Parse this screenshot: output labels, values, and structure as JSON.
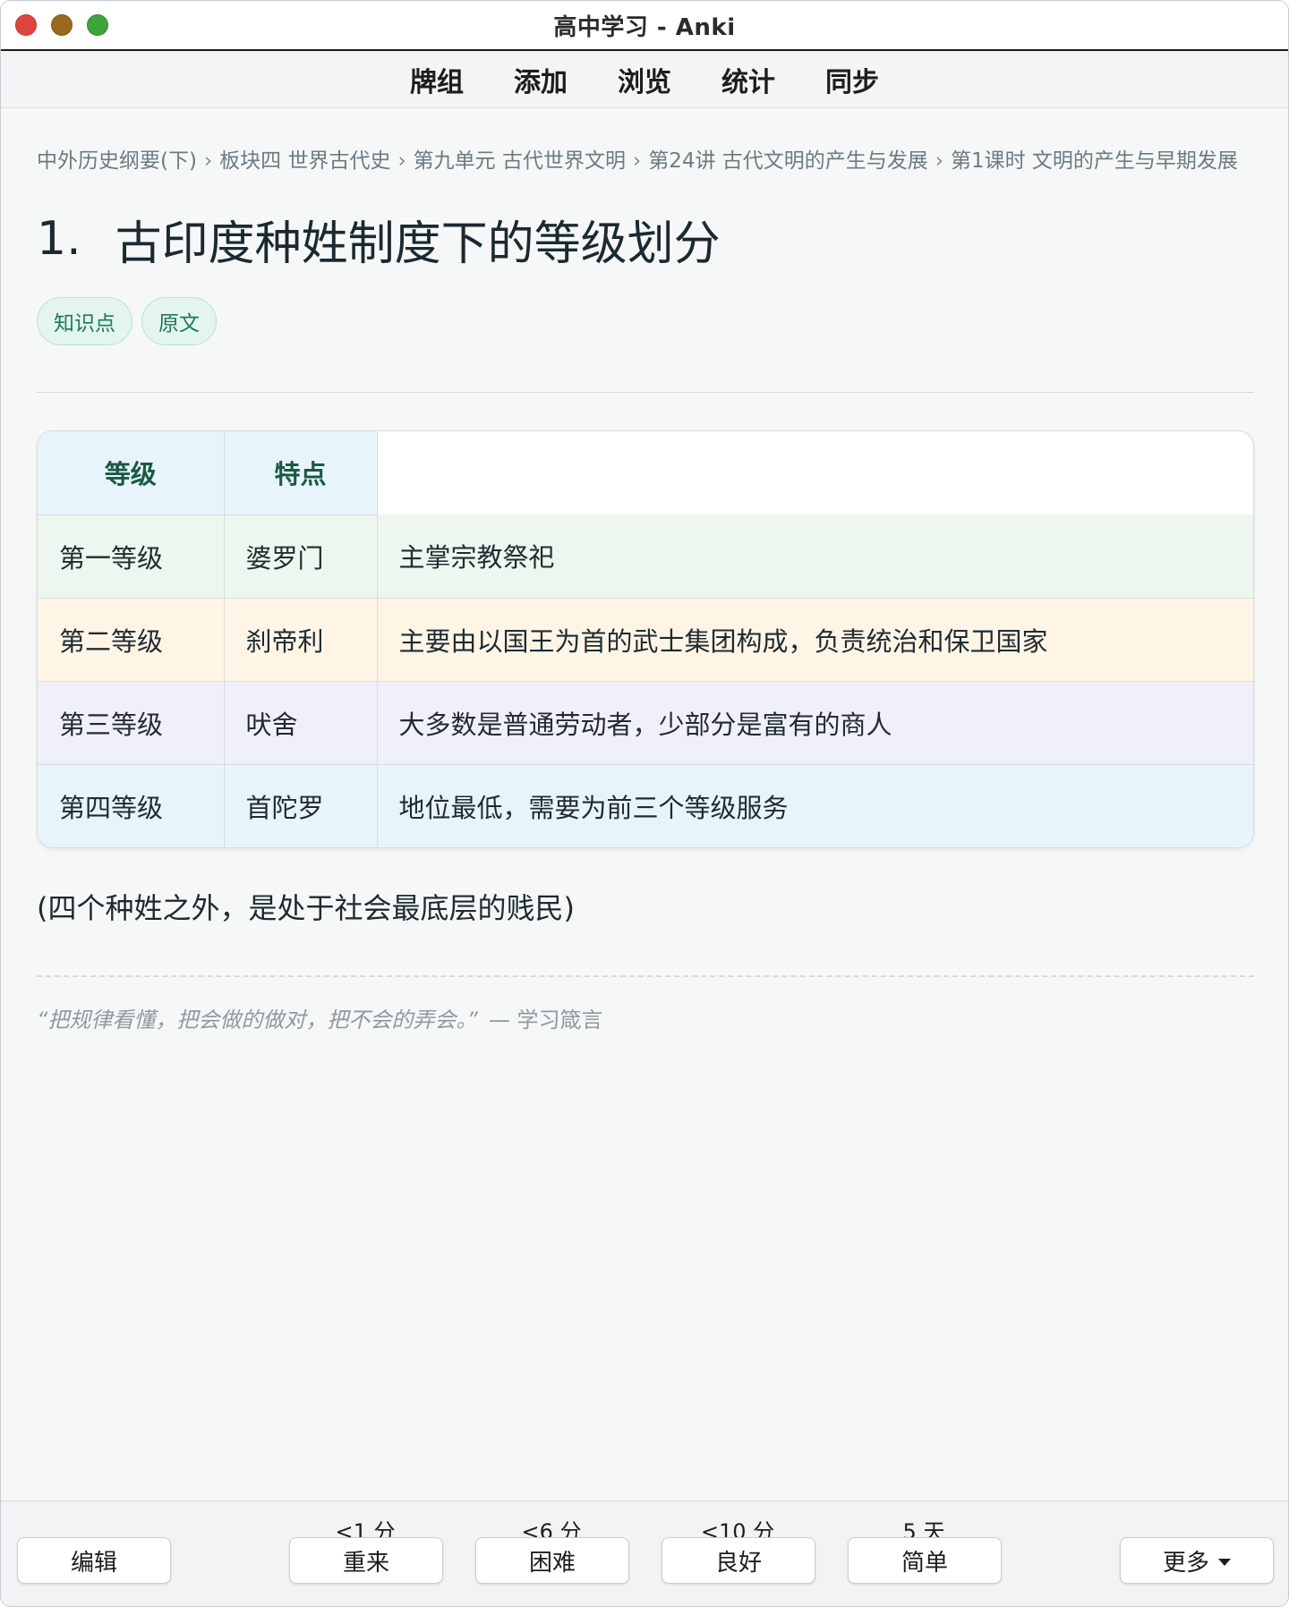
{
  "window": {
    "title": "高中学习 - Anki"
  },
  "nav": {
    "items": [
      "牌组",
      "添加",
      "浏览",
      "统计",
      "同步"
    ]
  },
  "card": {
    "breadcrumb": [
      "中外历史纲要(下)",
      "板块四 世界古代史",
      "第九单元 古代世界文明",
      "第24讲 古代文明的产生与发展",
      "第1课时 文明的产生与早期发展"
    ],
    "breadcrumb_sep": "›",
    "title_number": "1.",
    "title": "古印度种姓制度下的等级划分",
    "tags": [
      "知识点",
      "原文"
    ],
    "table": {
      "headers": [
        "等级",
        "特点"
      ],
      "rows": [
        {
          "level": "第一等级",
          "caste": "婆罗门",
          "desc": "主掌宗教祭祀"
        },
        {
          "level": "第二等级",
          "caste": "刹帝利",
          "desc": "主要由以国王为首的武士集团构成，负责统治和保卫国家"
        },
        {
          "level": "第三等级",
          "caste": "吠舍",
          "desc": "大多数是普通劳动者，少部分是富有的商人"
        },
        {
          "level": "第四等级",
          "caste": "首陀罗",
          "desc": "地位最低，需要为前三个等级服务"
        }
      ]
    },
    "footnote": "(四个种姓之外，是处于社会最底层的贱民)",
    "quote": "“把规律看懂，把会做的做对，把不会的弄会。”",
    "quote_author": "— 学习箴言"
  },
  "bottombar": {
    "edit_label": "编辑",
    "more_label": "更多",
    "answers": [
      {
        "interval": "<1 分",
        "label": "重来"
      },
      {
        "interval": "<6 分",
        "label": "困难"
      },
      {
        "interval": "<10 分",
        "label": "良好"
      },
      {
        "interval": "5 天",
        "label": "简单"
      }
    ]
  },
  "colors": {
    "tag_bg": "#e3f5ee",
    "tag_text": "#1e7a56",
    "row1_bg": "#edf7ef",
    "row2_bg": "#fff5e6",
    "row3_bg": "#f2effc",
    "row4_bg": "#e8f4fc",
    "header_text": "#1a5a44"
  },
  "icons": {
    "close": "close-icon",
    "minimize": "minimize-icon",
    "maximize": "maximize-icon",
    "more_caret": "chevron-down-icon"
  }
}
